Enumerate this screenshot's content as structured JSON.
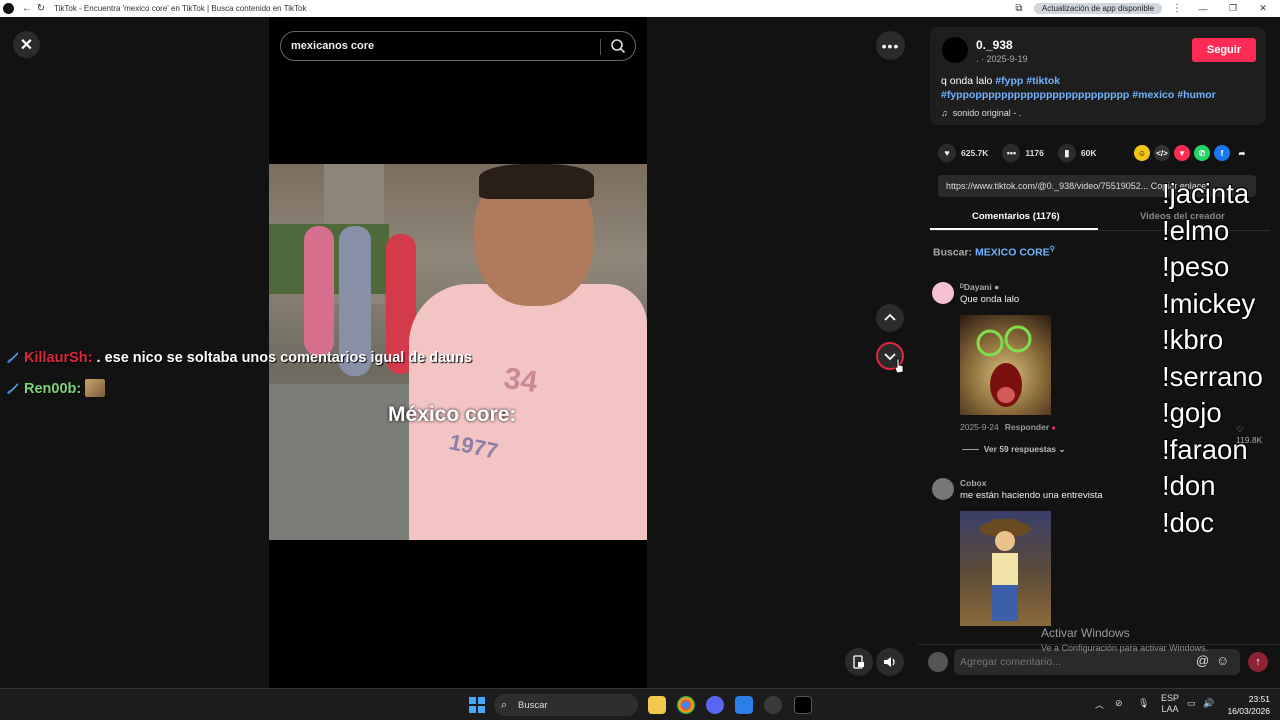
{
  "browser": {
    "title": "TikTok - Encuentra 'mexico core' en TikTok | Busca contenido en TikTok",
    "update_pill": "Actualización de app disponible"
  },
  "stage": {
    "search_value": "mexicanos core",
    "video_caption": "México core:",
    "chat": [
      {
        "user": "KillaurSh:",
        "message": " . ese nico se soltaba unos comentarios igual de dauns"
      },
      {
        "user": "Ren00b:",
        "message": ""
      }
    ]
  },
  "post": {
    "username": "0._938",
    "date": ". · 2025-9-19",
    "follow_label": "Seguir",
    "description_prefix": "q onda lalo ",
    "tags": [
      "#fypp",
      "#tiktok",
      "#fyppopppppppppppppppppppppppp",
      "#mexico",
      "#humor"
    ],
    "sound": "sonido original - .",
    "likes": "625.7K",
    "comments": "1176",
    "saves": "60K",
    "url": "https://www.tiktok.com/@0._938/video/75519052...",
    "url_copy": "Copiar enlace",
    "tab_comments": "Comentarios (1176)",
    "tab_creator": "Videos del creador",
    "search_label": "Buscar: ",
    "search_term": "MEXICO CORE"
  },
  "comments": [
    {
      "user": "ᴰDayani ●",
      "text": "Que onda lalo",
      "date": "2025-9-24",
      "reply": "Responder",
      "likes": "119.8K",
      "more": "Ver 59 respuestas"
    },
    {
      "user": "Cobox",
      "text": "me están haciendo una entrevista"
    }
  ],
  "comment_input": {
    "placeholder": "Agregar comentario..."
  },
  "overlay_commands": [
    "!jacinta",
    "!elmo",
    "!peso",
    "!mickey",
    "!kbro",
    "!serrano",
    "!gojo",
    "!faraon",
    "!don",
    "!doc"
  ],
  "watermark": {
    "title": "Activar Windows",
    "subtitle": "Ve a Configuración para activar Windows."
  },
  "taskbar": {
    "search": "Buscar",
    "lang": "ESP",
    "region": "LAA",
    "time": "23:51",
    "date": "16/03/2026"
  },
  "colors": {
    "accent": "#fe2c55",
    "tag": "#6fb4ff"
  }
}
